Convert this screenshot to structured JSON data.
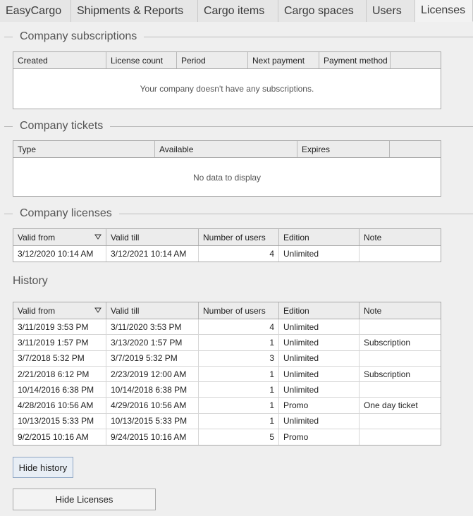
{
  "tabs": [
    "EasyCargo",
    "Shipments & Reports",
    "Cargo items",
    "Cargo spaces",
    "Users",
    "Licenses"
  ],
  "active_tab": "Licenses",
  "subscriptions": {
    "title": "Company subscriptions",
    "columns": [
      "Created",
      "License count",
      "Period",
      "Next payment",
      "Payment method"
    ],
    "empty_text": "Your company doesn't have any subscriptions."
  },
  "tickets": {
    "title": "Company tickets",
    "columns": [
      "Type",
      "Available",
      "Expires"
    ],
    "empty_text": "No data to display"
  },
  "licenses": {
    "title": "Company licenses",
    "columns": [
      "Valid from",
      "Valid till",
      "Number of users",
      "Edition",
      "Note"
    ],
    "rows": [
      [
        "3/12/2020 10:14 AM",
        "3/12/2021 10:14 AM",
        "4",
        "Unlimited",
        ""
      ]
    ]
  },
  "history": {
    "title": "History",
    "columns": [
      "Valid from",
      "Valid till",
      "Number of users",
      "Edition",
      "Note"
    ],
    "rows": [
      [
        "3/11/2019 3:53 PM",
        "3/11/2020 3:53 PM",
        "4",
        "Unlimited",
        ""
      ],
      [
        "3/11/2019 1:57 PM",
        "3/13/2020 1:57 PM",
        "1",
        "Unlimited",
        "Subscription"
      ],
      [
        "3/7/2018 5:32 PM",
        "3/7/2019 5:32 PM",
        "3",
        "Unlimited",
        ""
      ],
      [
        "2/21/2018 6:12 PM",
        "2/23/2019 12:00 AM",
        "1",
        "Unlimited",
        "Subscription"
      ],
      [
        "10/14/2016 6:38 PM",
        "10/14/2018 6:38 PM",
        "1",
        "Unlimited",
        ""
      ],
      [
        "4/28/2016 10:56 AM",
        "4/29/2016 10:56 AM",
        "1",
        "Promo",
        "One day ticket"
      ],
      [
        "10/13/2015 5:33 PM",
        "10/13/2015 5:33 PM",
        "1",
        "Unlimited",
        ""
      ],
      [
        "9/2/2015 10:16 AM",
        "9/24/2015 10:16 AM",
        "5",
        "Promo",
        ""
      ]
    ]
  },
  "buttons": {
    "hide_history": "Hide history",
    "hide_licenses": "Hide Licenses"
  }
}
